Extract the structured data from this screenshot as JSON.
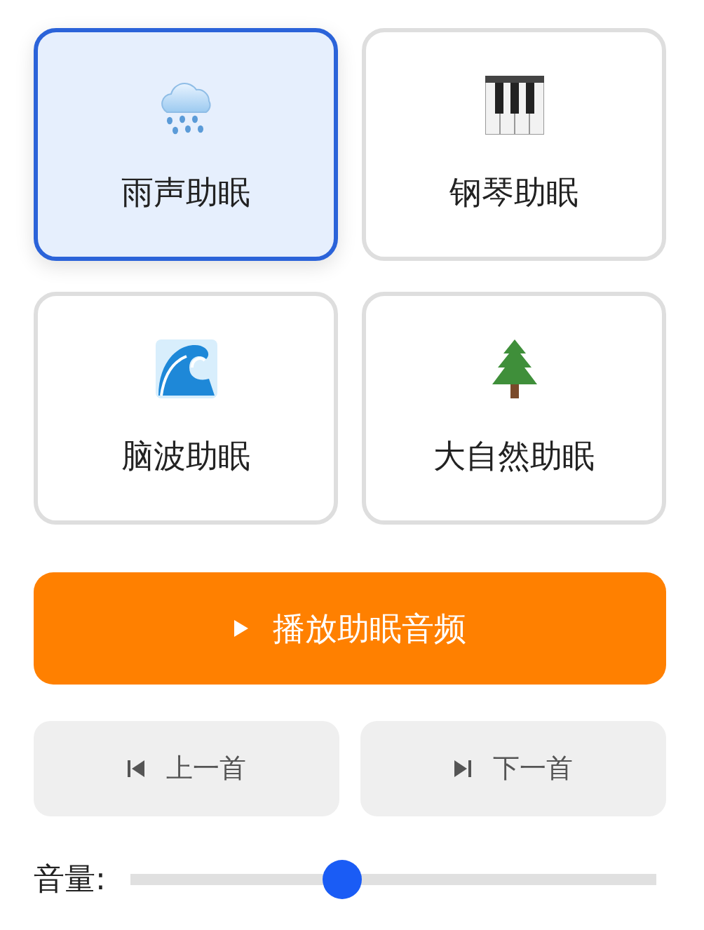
{
  "sounds": [
    {
      "label": "雨声助眠",
      "kind": "rain",
      "selected": true
    },
    {
      "label": "钢琴助眠",
      "kind": "piano",
      "selected": false
    },
    {
      "label": "脑波助眠",
      "kind": "wave",
      "selected": false
    },
    {
      "label": "大自然助眠",
      "kind": "tree",
      "selected": false
    }
  ],
  "play_button": {
    "label": "播放助眠音频"
  },
  "controls": [
    {
      "label": "上一首",
      "kind": "previous"
    },
    {
      "label": "下一首",
      "kind": "next"
    }
  ],
  "volume": {
    "label": "音量:",
    "level": 0.4
  }
}
